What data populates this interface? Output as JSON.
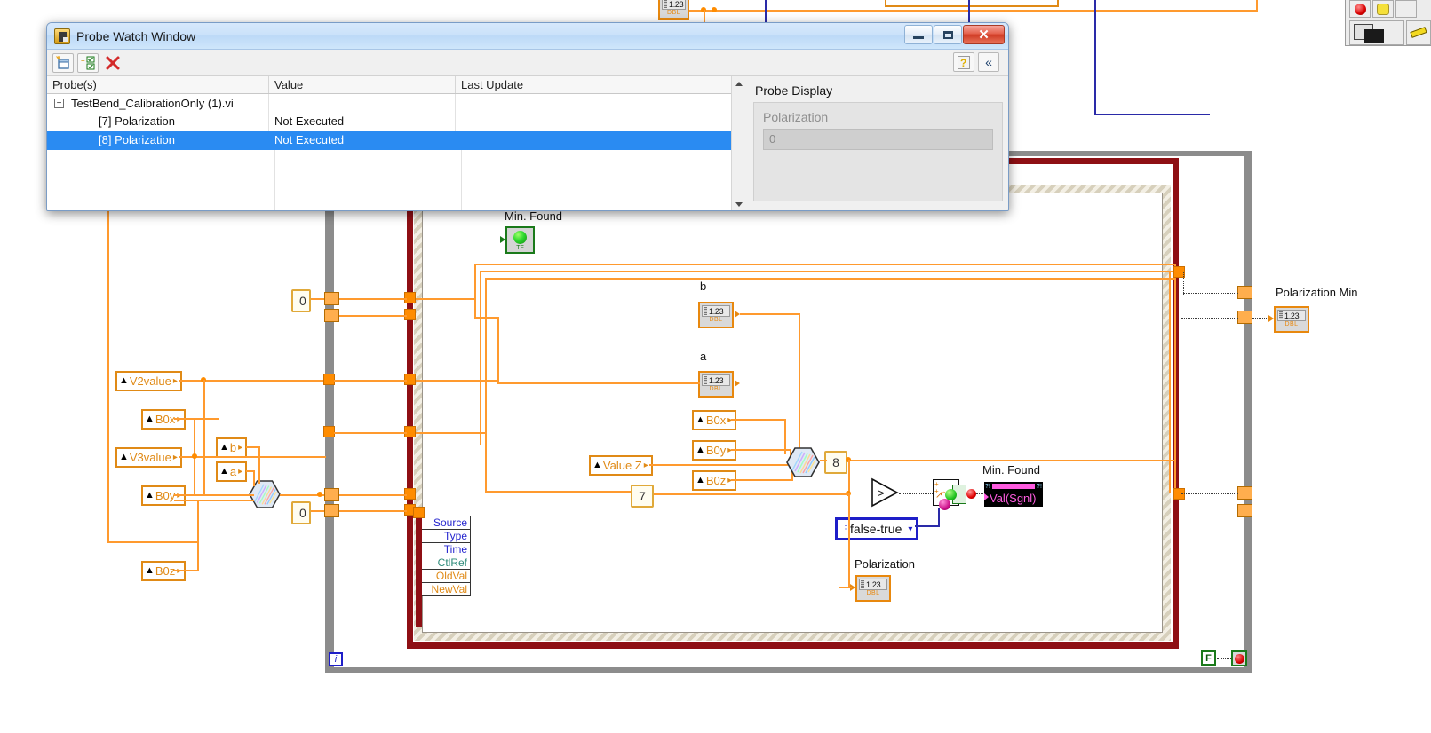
{
  "window": {
    "title": "Probe Watch Window",
    "icon": "labview-probe-icon",
    "buttons": {
      "minimize": "—",
      "maximize": "□",
      "close": "✕"
    },
    "toolbar": {
      "new_probe": "new-probe-button",
      "add_probe": "add-probe-button",
      "delete_probe": "delete-probe-button",
      "help": "?",
      "collapse": "«"
    }
  },
  "table": {
    "columns": [
      "Probe(s)",
      "Value",
      "Last Update"
    ],
    "rows": [
      {
        "probe": "TestBend_CalibrationOnly (1).vi",
        "value": "",
        "last_update": "",
        "level": 0,
        "expander": "−",
        "selected": false
      },
      {
        "probe": "[7] Polarization",
        "value": "Not Executed",
        "last_update": "",
        "level": 1,
        "expander": "",
        "selected": false
      },
      {
        "probe": "[8] Polarization",
        "value": "Not Executed",
        "last_update": "",
        "level": 1,
        "expander": "",
        "selected": true
      }
    ]
  },
  "probe_display": {
    "title": "Probe Display",
    "label": "Polarization",
    "value": "0"
  },
  "diagram": {
    "labels": {
      "min_found_led": "Min. Found",
      "b": "b",
      "a": "a",
      "polarization": "Polarization",
      "polarization_min": "Polarization Min",
      "min_found_sig": "Min. Found",
      "val_sgnl": "Val(Sgnl)"
    },
    "terminals": {
      "v2value": "V2value",
      "v3value": "V3value",
      "b0x_left": "B0x",
      "b0y_left": "B0y",
      "b0z_left": "B0z",
      "b_small": "b",
      "a_small": "a",
      "value_z": "Value Z",
      "b0x_mid": "B0x",
      "b0y_mid": "B0y",
      "b0z_mid": "B0z"
    },
    "constants": {
      "zero_top": "0",
      "zero_bottom": "0",
      "seven": "7",
      "eight": "8"
    },
    "enum_ring": {
      "value": "false-true"
    },
    "event_labels": [
      "Source",
      "Type",
      "Time",
      "CtlRef",
      "OldVal",
      "NewVal"
    ],
    "dbl_tag": "DBL",
    "dbl_sample": "1.23",
    "tf_tag": "TF",
    "loop_terminals": {
      "iteration": "i",
      "false_const": "F",
      "stop": "stop-button"
    }
  },
  "colors": {
    "wire_orange": "#ff9a2e",
    "wire_blue": "#2a2aa8",
    "terminal_border": "#e08a16",
    "case_border": "#8e0f14",
    "loop_border": "#8c8c8c",
    "selection_blue": "#2a8bf2",
    "led_green": "#2fd92f",
    "magenta": "#ff5ce0"
  }
}
